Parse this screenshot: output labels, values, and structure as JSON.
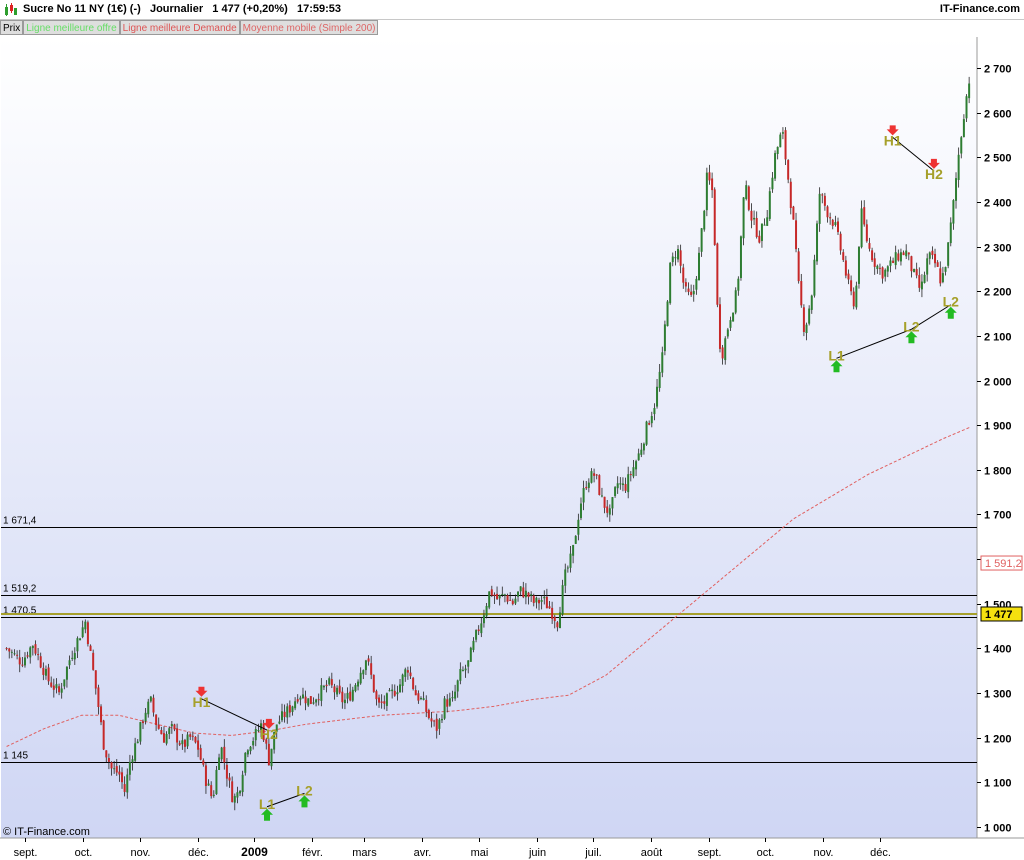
{
  "header": {
    "title": "Sucre No 11 NY (1€) (-)   Journalier   1 477 (+0,20%)   17:59:53",
    "brand": "IT-Finance.com"
  },
  "legend": {
    "items": [
      "Prix",
      "Ligne meilleure offre",
      "Ligne meilleure Demande",
      "Moyenne mobile (Simple 200)"
    ]
  },
  "footer": {
    "copyright": "© IT-Finance.com"
  },
  "colors": {
    "up_candle": "#2e7d32",
    "down_candle": "#c62828",
    "moving_average": "#e06060",
    "price_line": "#a6a02a",
    "price_tag": "#f5e10f",
    "ma_tag_border": "#e06060",
    "annotation": "#a6a02a",
    "arrow_down": "#ee3333",
    "arrow_up": "#22bb22"
  },
  "chart_data": {
    "type": "candlestick",
    "title": "Sucre No 11 NY (1€) (-)",
    "period": "Journalier",
    "last_value": "1 477",
    "last_change": "+0,20%",
    "y_ticks": [
      "1 000",
      "1 100",
      "1 200",
      "1 300",
      "1 400",
      "1 500",
      "1 600",
      "1 700",
      "1 800",
      "1 900",
      "2 000",
      "2 100",
      "2 200",
      "2 300",
      "2 400",
      "2 500",
      "2 600",
      "2 700"
    ],
    "y_tick_values": [
      1000,
      1100,
      1200,
      1300,
      1400,
      1500,
      1600,
      1700,
      1800,
      1900,
      2000,
      2100,
      2200,
      2300,
      2400,
      2500,
      2600,
      2700
    ],
    "ylim": [
      975,
      2770
    ],
    "x_labels": [
      "sept.",
      "oct.",
      "nov.",
      "déc.",
      "2009",
      "févr.",
      "mars",
      "avr.",
      "mai",
      "juin",
      "juil.",
      "août",
      "sept.",
      "oct.",
      "nov.",
      "déc."
    ],
    "x_label_days": [
      10,
      41,
      71,
      102,
      132,
      163,
      191,
      222,
      252,
      283,
      313,
      344,
      375,
      405,
      436,
      466
    ],
    "x_label_bold": [
      false,
      false,
      false,
      false,
      true,
      false,
      false,
      false,
      false,
      false,
      false,
      false,
      false,
      false,
      false,
      false
    ],
    "horizontal_lines": [
      {
        "label": "1 671,4",
        "value": 1671.4
      },
      {
        "label": "1 519,2",
        "value": 1519.2
      },
      {
        "label": "1 470,5",
        "value": 1470.5
      },
      {
        "label": "1 145",
        "value": 1145
      }
    ],
    "last_price_line": 1477,
    "right_tags": [
      {
        "text": "1 591,2",
        "value": 1591.2,
        "style": "ma"
      },
      {
        "text": "1 477",
        "value": 1477,
        "style": "price"
      }
    ],
    "price_path": [
      [
        0,
        1400
      ],
      [
        8,
        1370
      ],
      [
        14,
        1410
      ],
      [
        22,
        1330
      ],
      [
        28,
        1300
      ],
      [
        34,
        1380
      ],
      [
        38,
        1420
      ],
      [
        42,
        1460
      ],
      [
        48,
        1300
      ],
      [
        52,
        1180
      ],
      [
        56,
        1130
      ],
      [
        60,
        1120
      ],
      [
        63,
        1080
      ],
      [
        66,
        1150
      ],
      [
        70,
        1200
      ],
      [
        74,
        1260
      ],
      [
        77,
        1280
      ],
      [
        80,
        1230
      ],
      [
        84,
        1200
      ],
      [
        88,
        1220
      ],
      [
        94,
        1180
      ],
      [
        98,
        1200
      ],
      [
        102,
        1180
      ],
      [
        106,
        1110
      ],
      [
        110,
        1060
      ],
      [
        114,
        1190
      ],
      [
        118,
        1110
      ],
      [
        121,
        1060
      ],
      [
        124,
        1080
      ],
      [
        128,
        1180
      ],
      [
        132,
        1200
      ],
      [
        136,
        1230
      ],
      [
        140,
        1150
      ],
      [
        144,
        1230
      ],
      [
        148,
        1250
      ],
      [
        152,
        1270
      ],
      [
        156,
        1300
      ],
      [
        162,
        1280
      ],
      [
        167,
        1300
      ],
      [
        172,
        1320
      ],
      [
        176,
        1300
      ],
      [
        180,
        1280
      ],
      [
        184,
        1300
      ],
      [
        188,
        1340
      ],
      [
        192,
        1380
      ],
      [
        195,
        1330
      ],
      [
        198,
        1270
      ],
      [
        202,
        1280
      ],
      [
        206,
        1300
      ],
      [
        210,
        1320
      ],
      [
        214,
        1360
      ],
      [
        218,
        1300
      ],
      [
        222,
        1280
      ],
      [
        226,
        1240
      ],
      [
        230,
        1220
      ],
      [
        234,
        1280
      ],
      [
        238,
        1280
      ],
      [
        242,
        1340
      ],
      [
        246,
        1360
      ],
      [
        250,
        1420
      ],
      [
        254,
        1470
      ],
      [
        258,
        1530
      ],
      [
        262,
        1510
      ],
      [
        266,
        1520
      ],
      [
        270,
        1500
      ],
      [
        274,
        1530
      ],
      [
        278,
        1520
      ],
      [
        282,
        1500
      ],
      [
        286,
        1510
      ],
      [
        290,
        1490
      ],
      [
        294,
        1460
      ],
      [
        298,
        1560
      ],
      [
        302,
        1610
      ],
      [
        306,
        1720
      ],
      [
        310,
        1780
      ],
      [
        314,
        1790
      ],
      [
        318,
        1730
      ],
      [
        322,
        1700
      ],
      [
        326,
        1770
      ],
      [
        330,
        1760
      ],
      [
        334,
        1800
      ],
      [
        338,
        1840
      ],
      [
        342,
        1900
      ],
      [
        346,
        1950
      ],
      [
        350,
        2050
      ],
      [
        354,
        2250
      ],
      [
        358,
        2300
      ],
      [
        362,
        2200
      ],
      [
        366,
        2180
      ],
      [
        370,
        2290
      ],
      [
        374,
        2460
      ],
      [
        377,
        2420
      ],
      [
        380,
        2100
      ],
      [
        382,
        2060
      ],
      [
        386,
        2140
      ],
      [
        390,
        2200
      ],
      [
        394,
        2440
      ],
      [
        398,
        2360
      ],
      [
        402,
        2320
      ],
      [
        406,
        2380
      ],
      [
        410,
        2500
      ],
      [
        414,
        2560
      ],
      [
        417,
        2460
      ],
      [
        420,
        2350
      ],
      [
        423,
        2200
      ],
      [
        426,
        2110
      ],
      [
        430,
        2200
      ],
      [
        434,
        2420
      ],
      [
        438,
        2380
      ],
      [
        442,
        2350
      ],
      [
        446,
        2280
      ],
      [
        450,
        2200
      ],
      [
        453,
        2170
      ],
      [
        456,
        2380
      ],
      [
        460,
        2300
      ],
      [
        464,
        2260
      ],
      [
        468,
        2240
      ],
      [
        472,
        2260
      ],
      [
        476,
        2280
      ],
      [
        480,
        2290
      ],
      [
        484,
        2240
      ],
      [
        488,
        2200
      ],
      [
        492,
        2280
      ],
      [
        496,
        2260
      ],
      [
        499,
        2220
      ],
      [
        502,
        2280
      ],
      [
        505,
        2380
      ],
      [
        508,
        2500
      ],
      [
        511,
        2600
      ],
      [
        514,
        2680
      ]
    ],
    "moving_average": [
      [
        0,
        1180
      ],
      [
        20,
        1220
      ],
      [
        40,
        1250
      ],
      [
        60,
        1250
      ],
      [
        80,
        1230
      ],
      [
        100,
        1210
      ],
      [
        120,
        1205
      ],
      [
        140,
        1215
      ],
      [
        160,
        1230
      ],
      [
        180,
        1240
      ],
      [
        200,
        1250
      ],
      [
        220,
        1255
      ],
      [
        240,
        1260
      ],
      [
        260,
        1270
      ],
      [
        280,
        1285
      ],
      [
        300,
        1295
      ],
      [
        320,
        1340
      ],
      [
        340,
        1410
      ],
      [
        360,
        1480
      ],
      [
        380,
        1550
      ],
      [
        400,
        1620
      ],
      [
        420,
        1690
      ],
      [
        440,
        1740
      ],
      [
        460,
        1790
      ],
      [
        480,
        1830
      ],
      [
        500,
        1870
      ],
      [
        514,
        1895
      ]
    ],
    "annotations": [
      {
        "label": "H1",
        "day": 104,
        "value": 1287,
        "marker": "down"
      },
      {
        "label": "H2",
        "day": 140,
        "value": 1215,
        "marker": "down"
      },
      {
        "label": "L1",
        "day": 139,
        "value": 1045,
        "marker": "up"
      },
      {
        "label": "L2",
        "day": 159,
        "value": 1075,
        "marker": "up"
      },
      {
        "label": "H1",
        "day": 473,
        "value": 2545,
        "marker": "down"
      },
      {
        "label": "H2",
        "day": 495,
        "value": 2470,
        "marker": "down"
      },
      {
        "label": "L1",
        "day": 443,
        "value": 2050,
        "marker": "up"
      },
      {
        "label": "L2",
        "day": 483,
        "value": 2115,
        "marker": "up"
      },
      {
        "label": "L2",
        "day": 504,
        "value": 2170,
        "marker": "up"
      }
    ],
    "annotation_links": [
      [
        0,
        1
      ],
      [
        2,
        3
      ],
      [
        4,
        5
      ],
      [
        6,
        7
      ],
      [
        7,
        8
      ]
    ],
    "grid": false,
    "legend": "top-left"
  }
}
